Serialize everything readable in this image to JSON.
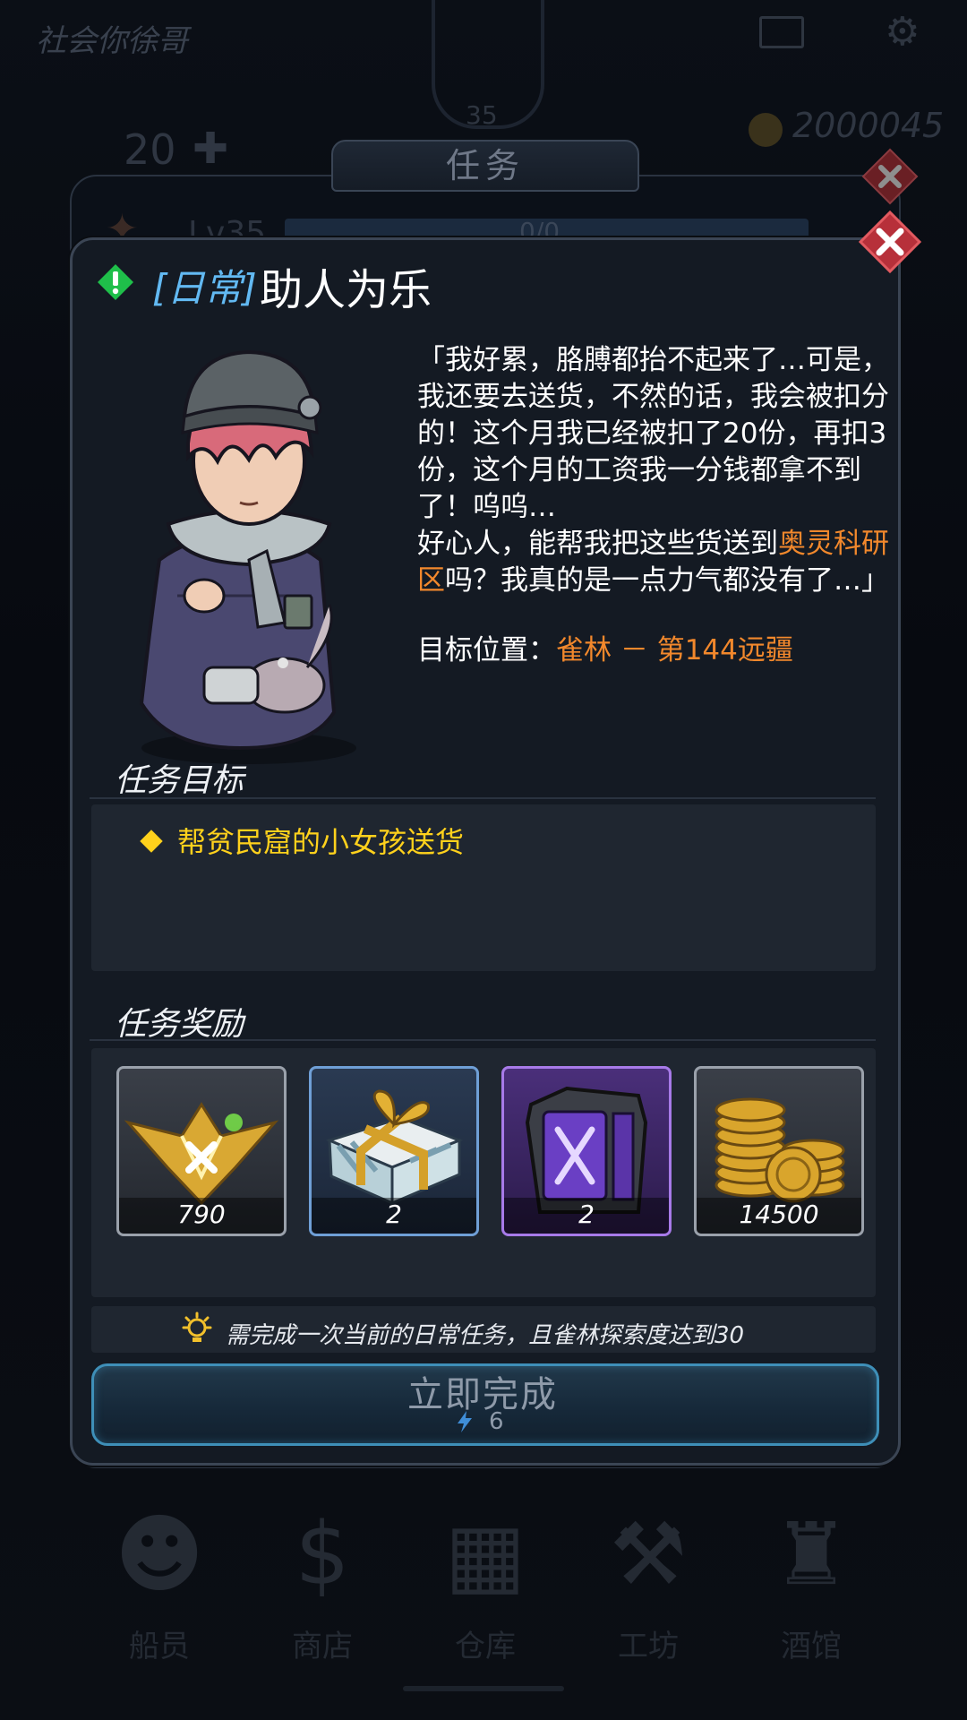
{
  "background": {
    "player_name": "社会你徐哥",
    "badge_level": "35",
    "energy": "20",
    "coins": "2000045",
    "level_label": "Lv35",
    "progress_text": "0/0",
    "tab_title": "任务",
    "nav": [
      {
        "label": "船员",
        "icon": "crew-icon"
      },
      {
        "label": "商店",
        "icon": "shop-icon"
      },
      {
        "label": "仓库",
        "icon": "warehouse-icon"
      },
      {
        "label": "工坊",
        "icon": "workshop-icon"
      },
      {
        "label": "酒馆",
        "icon": "tavern-icon"
      }
    ]
  },
  "dialog": {
    "tag": "[日常]",
    "title": "助人为乐",
    "story_part1": "「我好累，胳膊都抬不起来了…可是，我还要去送货，不然的话，我会被扣分的！这个月我已经被扣了20份，再扣3份，这个月的工资我一分钱都拿不到了！呜呜…",
    "story_part2a": "好心人，能帮我把这些货送到",
    "story_highlight": "奥灵科研区",
    "story_part2b": "吗？我真的是一点力气都没有了…」",
    "target_label": "目标位置：",
    "target_value": "雀林  －  第144远疆",
    "goal_heading": "任务目标",
    "goal_item": "帮贫民窟的小女孩送货",
    "reward_heading": "任务奖励",
    "rewards": [
      {
        "name": "xp-emblem",
        "qty": "790",
        "rarity": "gray"
      },
      {
        "name": "gift-box",
        "qty": "2",
        "rarity": "blue"
      },
      {
        "name": "purple-crate",
        "qty": "2",
        "rarity": "purple"
      },
      {
        "name": "gold-coins",
        "qty": "14500",
        "rarity": "gray"
      }
    ],
    "hint": "需完成一次当前的日常任务，且雀林探索度达到30",
    "finish_label": "立即完成",
    "finish_cost": "6"
  },
  "colors": {
    "accent_blue": "#62b9f2",
    "highlight_orange": "#f2882c",
    "goal_yellow": "#ffd11c",
    "close_red": "#c0353c"
  }
}
